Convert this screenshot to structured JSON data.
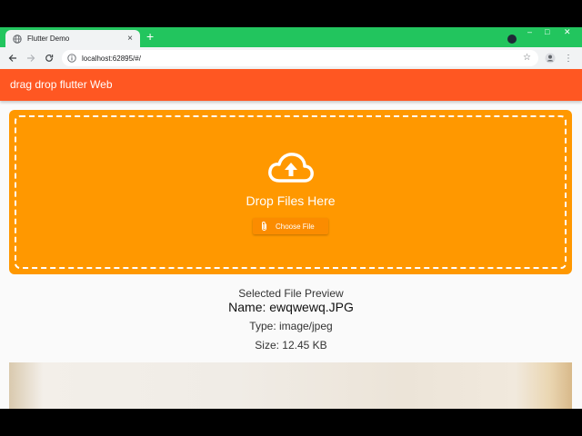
{
  "browser": {
    "tab_title": "Flutter Demo",
    "tab_close": "×",
    "new_tab": "+",
    "url": "localhost:62895/#/",
    "window_controls": [
      "–",
      "□",
      "✕"
    ]
  },
  "appbar": {
    "title": "drag drop flutter Web",
    "color": "#ff5722"
  },
  "dropzone": {
    "icon": "cloud-upload-icon",
    "text": "Drop Files Here",
    "button_icon": "paperclip-icon",
    "button_label": "Choose File",
    "color": "#ff9800"
  },
  "preview": {
    "title": "Selected File Preview",
    "name": "Name: ewqwewq.JPG",
    "type": "Type: image/jpeg",
    "size": "Size: 12.45 KB"
  }
}
